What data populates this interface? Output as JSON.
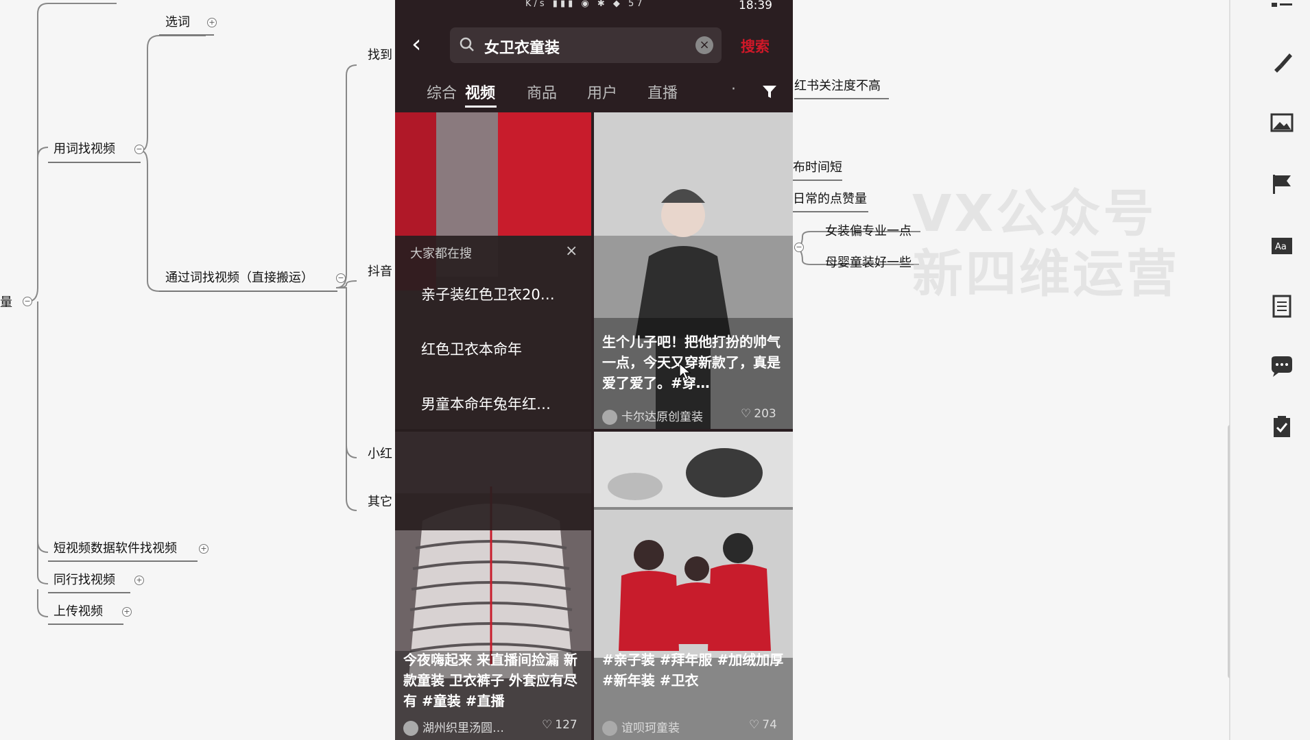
{
  "mindmap": {
    "root_partial": "量",
    "branches": {
      "xuanci": "选词",
      "yongci": "用词找视频",
      "tongguo": "通过词找视频（直接搬运）",
      "duanshipin": "短视频数据软件找视频",
      "tonghang": "同行找视频",
      "shangchuan": "上传视频",
      "zhaodao": "找到",
      "douyin": "抖音",
      "xiaohong": "小红",
      "qita": "其它",
      "hongshu": "红书关注度不高",
      "shijian": "布时间短",
      "dianzan": "日常的点赞量",
      "nvzhuang": "女装偏专业一点",
      "muying": "母婴童装好一些"
    },
    "watermark": [
      "VX公众号",
      "新四维运营"
    ]
  },
  "phone": {
    "status": {
      "time": "18:39",
      "icons": "K/s ▮▮▮ ◉ ✱ ◆ 57"
    },
    "search": {
      "query": "女卫衣童装",
      "clear": "×",
      "button": "搜索",
      "back": "‹"
    },
    "tabs": [
      "综合",
      "视频",
      "商品",
      "用户",
      "直播",
      "·"
    ],
    "suggestions": {
      "title": "大家都在搜",
      "close": "×",
      "items": [
        "亲子装红色卫衣20…",
        "红色卫衣本命年",
        "男童本命年兔年红…"
      ]
    },
    "cards": [
      {
        "caption": "生个儿子吧！把他打扮的帅气一点，今天又穿新款了，真是爱了爱了。#穿…",
        "author": "卡尔达原创童装",
        "likes": "203"
      },
      {
        "caption": "今夜嗨起来 来直播间捡漏 新款童装 卫衣裤子 外套应有尽有 #童装 #直播",
        "author": "湖州织里汤圆…",
        "likes": "127"
      },
      {
        "caption": "#亲子装 #拜年服 #加绒加厚 #新年装 #卫衣",
        "author": "谊呗珂童装",
        "likes": "74"
      }
    ]
  },
  "colors": {
    "accent": "#d01828",
    "phone_bg": "#2a1e21"
  }
}
